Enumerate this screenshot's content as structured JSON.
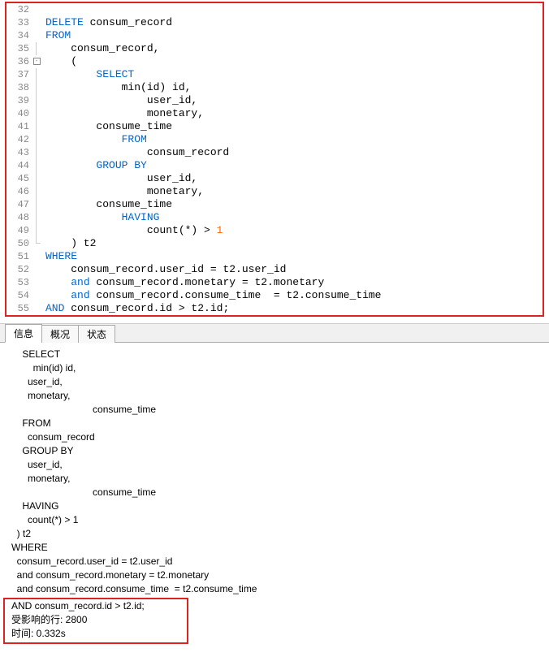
{
  "editor": {
    "lines": [
      {
        "n": 32,
        "fold": "",
        "seg": []
      },
      {
        "n": 33,
        "fold": "",
        "seg": [
          {
            "t": "DELETE",
            "c": "kw"
          },
          {
            "t": " consum_record"
          }
        ]
      },
      {
        "n": 34,
        "fold": "",
        "seg": [
          {
            "t": "FROM",
            "c": "kw"
          }
        ]
      },
      {
        "n": 35,
        "fold": "line",
        "seg": [
          {
            "t": "    consum_record,"
          }
        ]
      },
      {
        "n": 36,
        "fold": "box",
        "seg": [
          {
            "t": "    ("
          }
        ]
      },
      {
        "n": 37,
        "fold": "line",
        "seg": [
          {
            "t": "        "
          },
          {
            "t": "SELECT",
            "c": "kw"
          }
        ]
      },
      {
        "n": 38,
        "fold": "line",
        "seg": [
          {
            "t": "            min(id) id,"
          }
        ]
      },
      {
        "n": 39,
        "fold": "line",
        "seg": [
          {
            "t": "                user_id,"
          }
        ]
      },
      {
        "n": 40,
        "fold": "line",
        "seg": [
          {
            "t": "                monetary,"
          }
        ]
      },
      {
        "n": 41,
        "fold": "line",
        "seg": [
          {
            "t": "        consume_time"
          }
        ]
      },
      {
        "n": 42,
        "fold": "line",
        "seg": [
          {
            "t": "            "
          },
          {
            "t": "FROM",
            "c": "kw"
          }
        ]
      },
      {
        "n": 43,
        "fold": "line",
        "seg": [
          {
            "t": "                consum_record"
          }
        ]
      },
      {
        "n": 44,
        "fold": "line",
        "seg": [
          {
            "t": "        "
          },
          {
            "t": "GROUP BY",
            "c": "kw"
          }
        ]
      },
      {
        "n": 45,
        "fold": "line",
        "seg": [
          {
            "t": "                user_id,"
          }
        ]
      },
      {
        "n": 46,
        "fold": "line",
        "seg": [
          {
            "t": "                monetary,"
          }
        ]
      },
      {
        "n": 47,
        "fold": "line",
        "seg": [
          {
            "t": "        consume_time"
          }
        ]
      },
      {
        "n": 48,
        "fold": "line",
        "seg": [
          {
            "t": "            "
          },
          {
            "t": "HAVING",
            "c": "kw"
          }
        ]
      },
      {
        "n": 49,
        "fold": "line",
        "seg": [
          {
            "t": "                count(*) > "
          },
          {
            "t": "1",
            "c": "num"
          }
        ]
      },
      {
        "n": 50,
        "fold": "end",
        "seg": [
          {
            "t": "    ) t2"
          }
        ]
      },
      {
        "n": 51,
        "fold": "",
        "seg": [
          {
            "t": "WHERE",
            "c": "kw"
          }
        ]
      },
      {
        "n": 52,
        "fold": "",
        "seg": [
          {
            "t": "    consum_record.user_id = t2.user_id"
          }
        ]
      },
      {
        "n": 53,
        "fold": "",
        "seg": [
          {
            "t": "    "
          },
          {
            "t": "and",
            "c": "kw"
          },
          {
            "t": " consum_record.monetary = t2.monetary"
          }
        ]
      },
      {
        "n": 54,
        "fold": "",
        "seg": [
          {
            "t": "    "
          },
          {
            "t": "and",
            "c": "kw"
          },
          {
            "t": " consum_record.consume_time  = t2.consume_time"
          }
        ]
      },
      {
        "n": 55,
        "fold": "",
        "seg": [
          {
            "t": "AND",
            "c": "kw"
          },
          {
            "t": " consum_record.id > t2.id;"
          }
        ]
      }
    ]
  },
  "tabs": {
    "t0": "信息",
    "t1": "概况",
    "t2": "状态"
  },
  "output": {
    "lines": [
      "    SELECT",
      "        min(id) id,",
      "      user_id,",
      "      monetary,",
      "                              consume_time",
      "    FROM",
      "      consum_record",
      "    GROUP BY",
      "      user_id,",
      "      monetary,",
      "                              consume_time",
      "    HAVING",
      "      count(*) > 1",
      "  ) t2",
      "WHERE",
      "  consum_record.user_id = t2.user_id",
      "  and consum_record.monetary = t2.monetary",
      "  and consum_record.consume_time  = t2.consume_time"
    ],
    "result": {
      "l1": "AND consum_record.id > t2.id;",
      "l2": "受影响的行: 2800",
      "l3": "时间: 0.332s"
    }
  }
}
